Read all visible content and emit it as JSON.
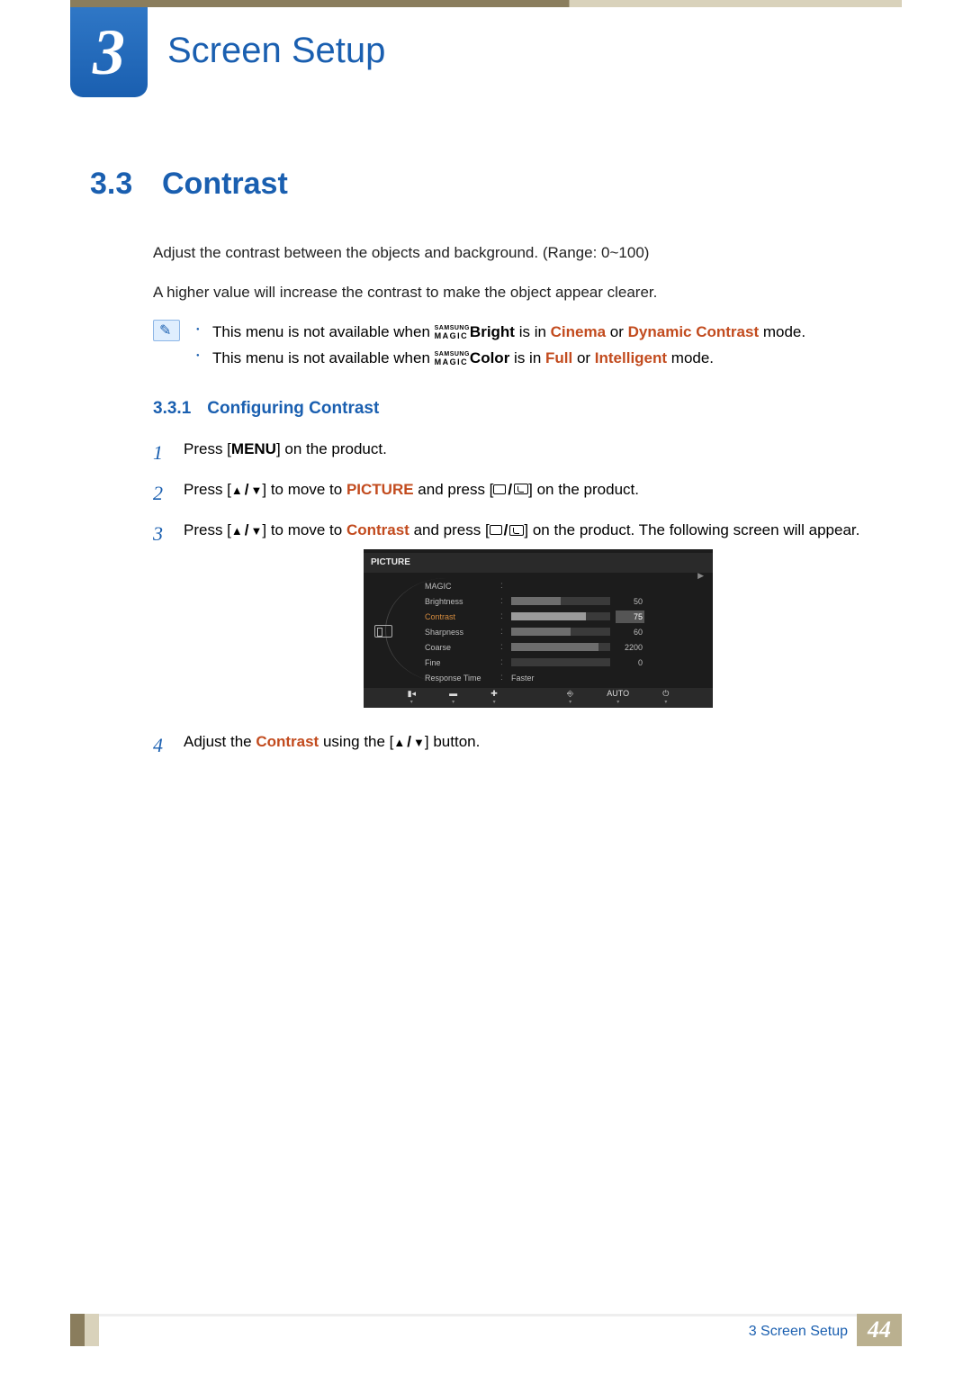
{
  "chapter": {
    "number": "3",
    "title": "Screen Setup"
  },
  "section": {
    "number": "3.3",
    "title": "Contrast"
  },
  "intro": {
    "p1": "Adjust the contrast between the objects and background. (Range: 0~100)",
    "p2": "A higher value will increase the contrast to make the object appear clearer."
  },
  "magic_brand": {
    "top": "SAMSUNG",
    "bottom": "MAGIC"
  },
  "notes": {
    "n1": {
      "pre": "This menu is not available when ",
      "logo_suffix": "Bright",
      "mid": " is in ",
      "m1": "Cinema",
      "or": " or ",
      "m2": "Dynamic Contrast",
      "post": " mode."
    },
    "n2": {
      "pre": "This menu is not available when ",
      "logo_suffix": "Color",
      "mid": " is in ",
      "m1": "Full",
      "or": " or ",
      "m2": "Intelligent",
      "post": " mode."
    }
  },
  "subsection": {
    "number": "3.3.1",
    "title": "Configuring Contrast"
  },
  "steps": {
    "s1": {
      "n": "1",
      "a": "Press [",
      "menu": "MENU",
      "b": "] on the product."
    },
    "s2": {
      "n": "2",
      "a": "Press [",
      "b": "] to move to ",
      "kw": "PICTURE",
      "c": " and press [",
      "d": "] on the product."
    },
    "s3": {
      "n": "3",
      "a": "Press [",
      "b": "] to move to ",
      "kw": "Contrast",
      "c": " and press [",
      "d": "] on the product. The following screen will appear."
    },
    "s4": {
      "n": "4",
      "a": "Adjust the ",
      "kw": "Contrast",
      "b": " using the [",
      "c": "] button."
    }
  },
  "osd": {
    "title": "PICTURE",
    "rows": [
      {
        "label": "MAGIC",
        "value": "",
        "bar": null,
        "arrow": true
      },
      {
        "label": "Brightness",
        "value": "50",
        "bar": 50
      },
      {
        "label": "Contrast",
        "value": "75",
        "bar": 75,
        "selected": true
      },
      {
        "label": "Sharpness",
        "value": "60",
        "bar": 60
      },
      {
        "label": "Coarse",
        "value": "2200",
        "bar": 88
      },
      {
        "label": "Fine",
        "value": "0",
        "bar": 0
      },
      {
        "label": "Response Time",
        "value": "Faster",
        "bar": null
      }
    ],
    "footer": {
      "auto": "AUTO"
    }
  },
  "footer": {
    "chapter_label": "3 Screen Setup",
    "page": "44"
  }
}
